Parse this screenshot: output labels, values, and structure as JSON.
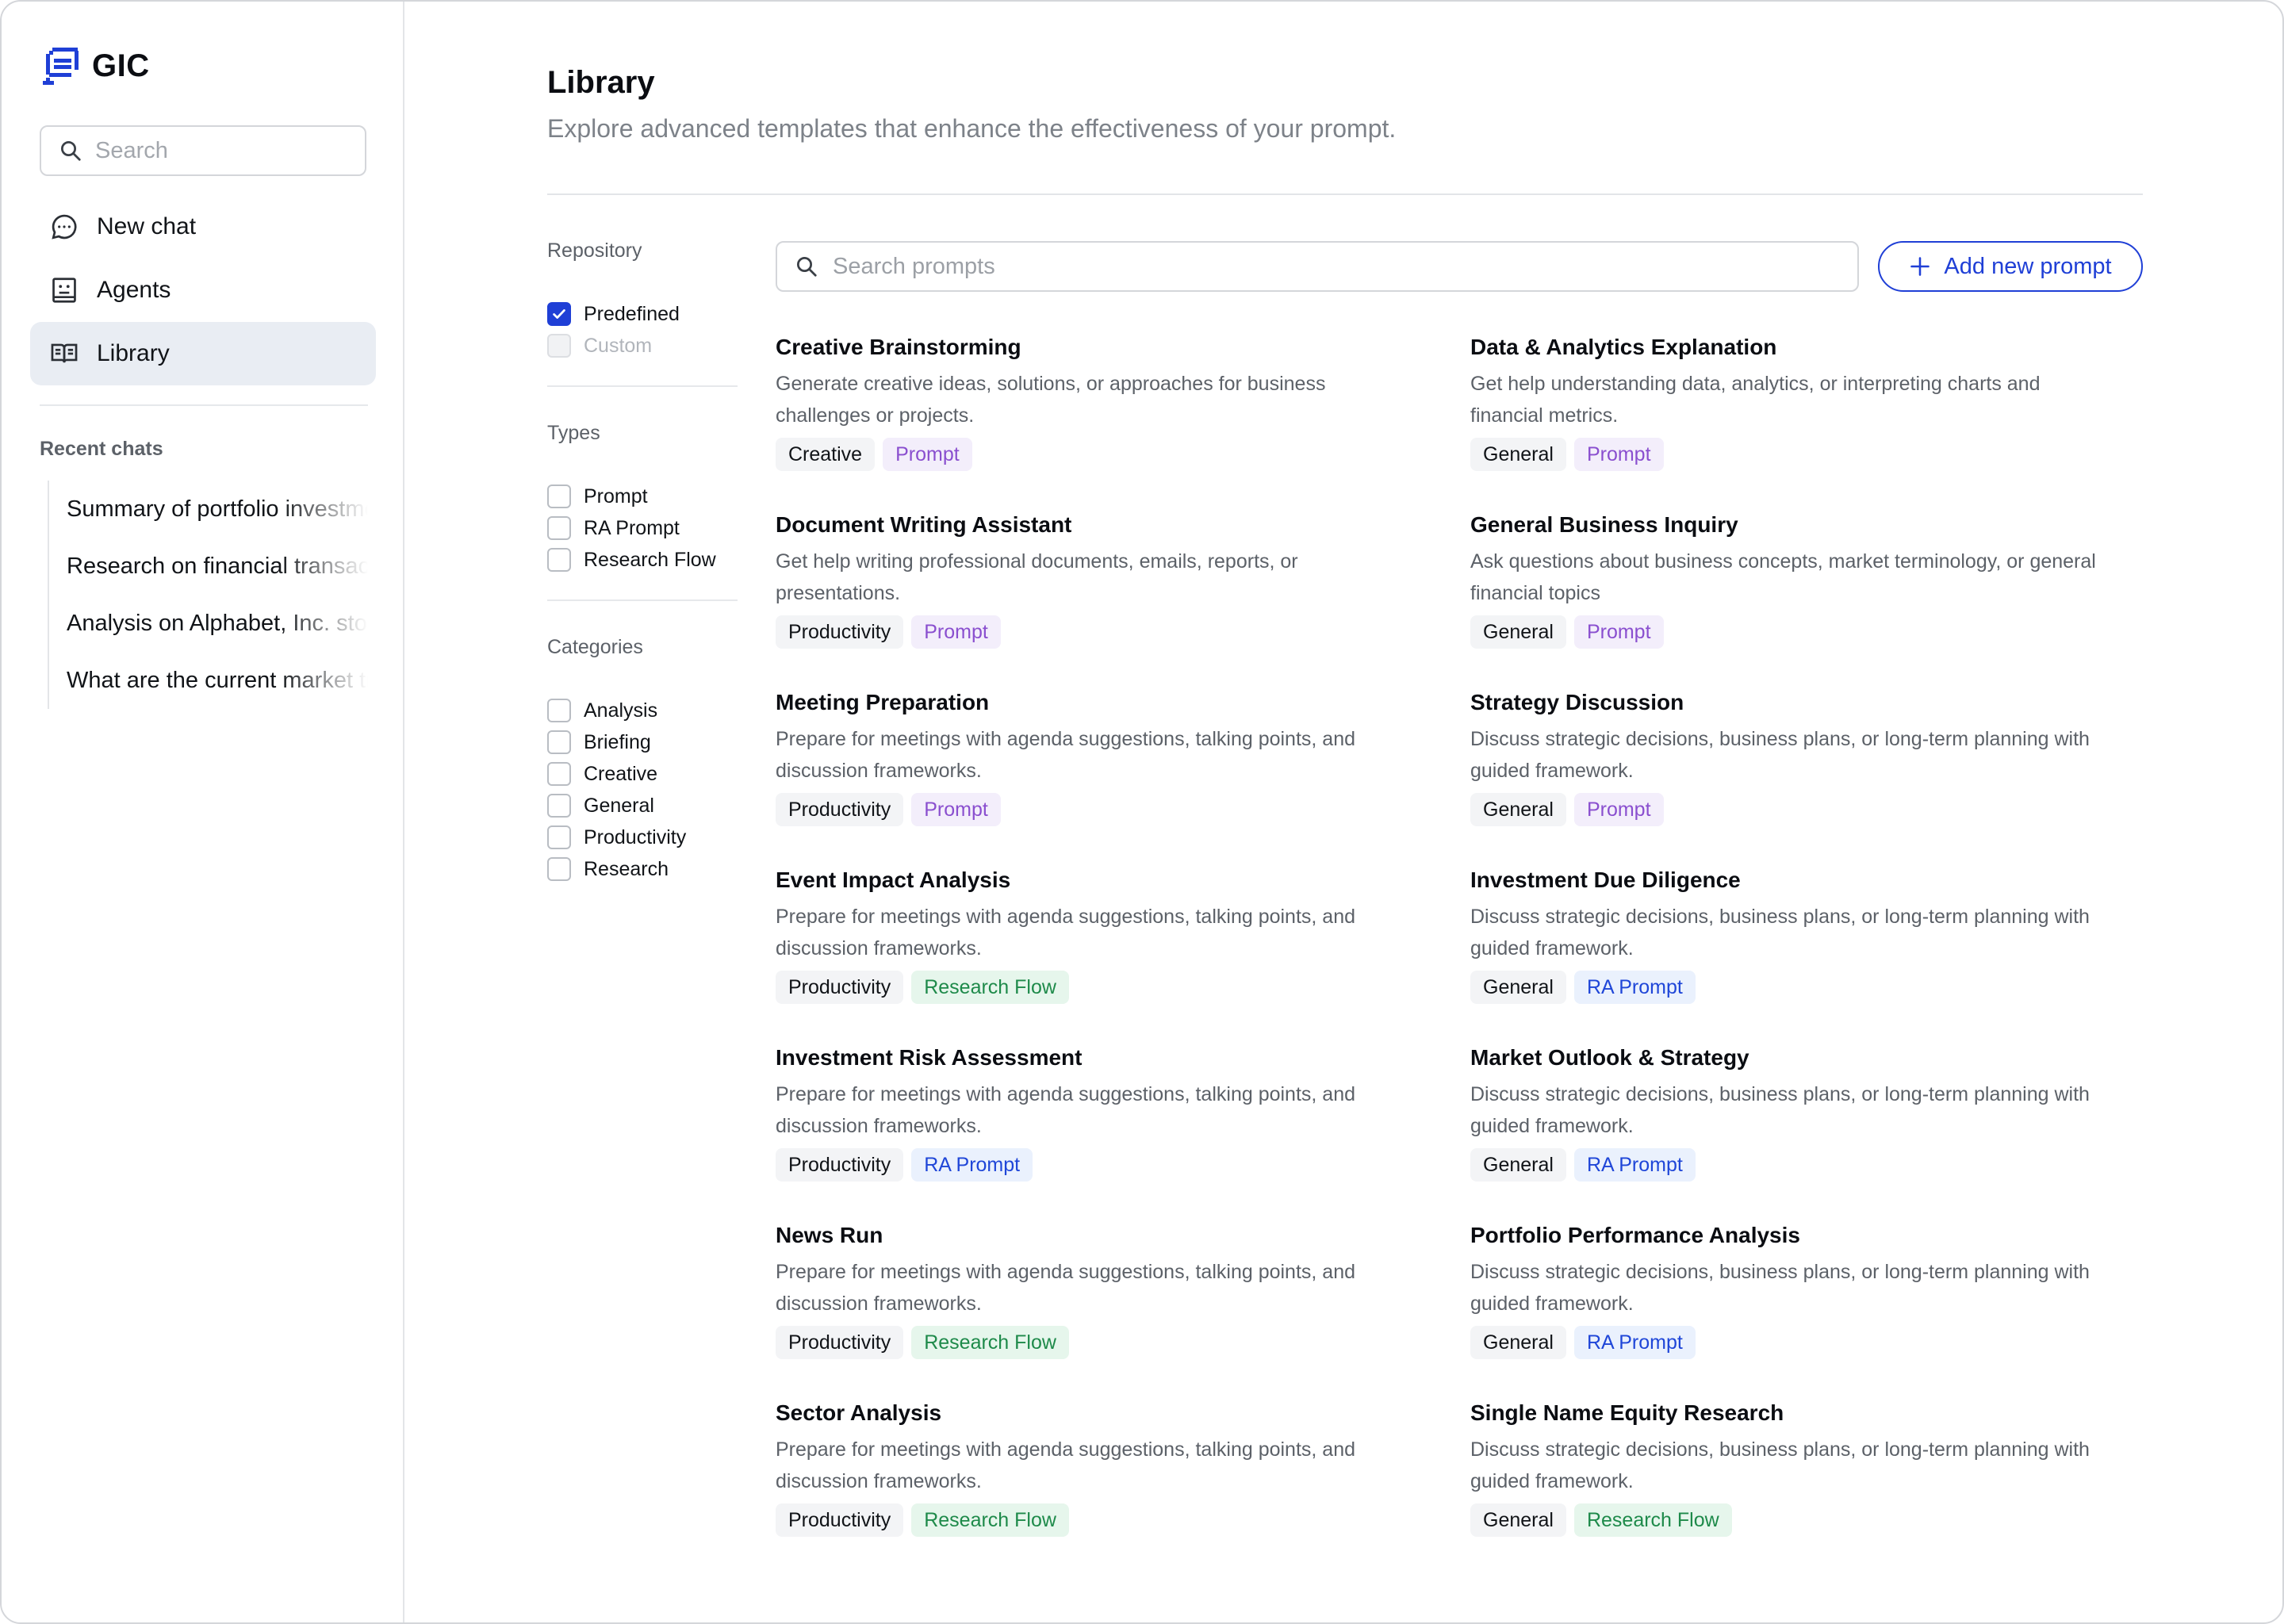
{
  "app": {
    "brand": "GIC"
  },
  "sidebar": {
    "search_placeholder": "Search",
    "nav": [
      {
        "label": "New chat",
        "icon": "chat-bubble-icon"
      },
      {
        "label": "Agents",
        "icon": "agent-icon"
      },
      {
        "label": "Library",
        "icon": "book-icon",
        "active": true
      }
    ],
    "recent_title": "Recent chats",
    "recent": [
      "Summary of portfolio investments",
      "Research on financial transactions",
      "Analysis on Alphabet, Inc. stock",
      "What are the current market trends"
    ]
  },
  "main": {
    "title": "Library",
    "subtitle": "Explore advanced templates that enhance the effectiveness of your prompt.",
    "search_placeholder": "Search prompts",
    "add_button": "Add new prompt"
  },
  "filters": {
    "repository": {
      "title": "Repository",
      "options": [
        {
          "label": "Predefined",
          "checked": true
        },
        {
          "label": "Custom",
          "disabled": true
        }
      ]
    },
    "types": {
      "title": "Types",
      "options": [
        "Prompt",
        "RA Prompt",
        "Research Flow"
      ]
    },
    "categories": {
      "title": "Categories",
      "options": [
        "Analysis",
        "Briefing",
        "Creative",
        "General",
        "Productivity",
        "Research"
      ]
    }
  },
  "cards": [
    {
      "title": "Creative Brainstorming",
      "desc": "Generate creative ideas, solutions, or approaches for business challenges or projects.",
      "category": "Creative",
      "type": "Prompt"
    },
    {
      "title": "Data & Analytics Explanation",
      "desc": "Get help understanding data, analytics, or interpreting charts and financial metrics.",
      "category": "General",
      "type": "Prompt"
    },
    {
      "title": "Document Writing Assistant",
      "desc": "Get help writing professional documents, emails, reports, or presentations.",
      "category": "Productivity",
      "type": "Prompt"
    },
    {
      "title": "General Business Inquiry",
      "desc": "Ask questions about business concepts, market terminology, or general financial topics",
      "category": "General",
      "type": "Prompt"
    },
    {
      "title": "Meeting Preparation",
      "desc": "Prepare for meetings with agenda suggestions, talking points, and discussion frameworks.",
      "category": "Productivity",
      "type": "Prompt"
    },
    {
      "title": "Strategy Discussion",
      "desc": "Discuss strategic decisions, business plans, or long-term planning with guided framework.",
      "category": "General",
      "type": "Prompt"
    },
    {
      "title": "Event Impact Analysis",
      "desc": "Prepare for meetings with agenda suggestions, talking points, and discussion frameworks.",
      "category": "Productivity",
      "type": "Research Flow"
    },
    {
      "title": "Investment Due Diligence",
      "desc": "Discuss strategic decisions, business plans, or long-term planning with guided framework.",
      "category": "General",
      "type": "RA Prompt"
    },
    {
      "title": "Investment Risk Assessment",
      "desc": "Prepare for meetings with agenda suggestions, talking points, and discussion frameworks.",
      "category": "Productivity",
      "type": "RA Prompt"
    },
    {
      "title": "Market Outlook & Strategy",
      "desc": "Discuss strategic decisions, business plans, or long-term planning with guided framework.",
      "category": "General",
      "type": "RA Prompt"
    },
    {
      "title": "News Run",
      "desc": "Prepare for meetings with agenda suggestions, talking points, and discussion frameworks.",
      "category": "Productivity",
      "type": "Research Flow"
    },
    {
      "title": "Portfolio Performance Analysis",
      "desc": "Discuss strategic decisions, business plans, or long-term planning with guided framework.",
      "category": "General",
      "type": "RA Prompt"
    },
    {
      "title": "Sector Analysis",
      "desc": "Prepare for meetings with agenda suggestions, talking points, and discussion frameworks.",
      "category": "Productivity",
      "type": "Research Flow"
    },
    {
      "title": "Single Name Equity Research",
      "desc": "Discuss strategic decisions, business plans, or long-term planning with guided framework.",
      "category": "General",
      "type": "Research Flow"
    }
  ],
  "colors": {
    "accent": "#1f3fd6",
    "prompt_tag": "#8a4fcf",
    "ra_prompt_tag": "#1f46d8",
    "research_flow_tag": "#1e8a4a",
    "active_nav_bg": "#e9edf3"
  }
}
